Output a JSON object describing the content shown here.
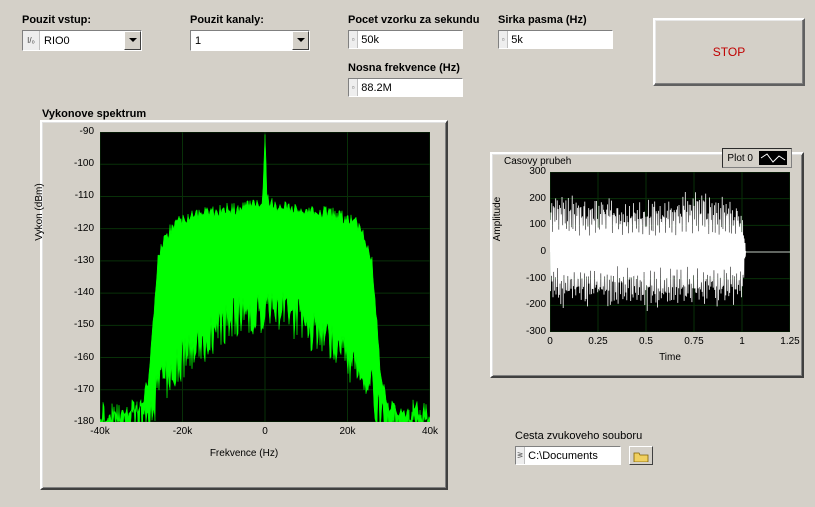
{
  "labels": {
    "input": "Pouzit vstup:",
    "channels": "Pouzit kanaly:",
    "samples": "Pocet vzorku za sekundu",
    "bandwidth": "Sirka pasma (Hz)",
    "carrier": "Nosna frekvence (Hz)",
    "stop": "STOP",
    "spectrum_title": "Vykonove spektrum",
    "spectrum_x": "Frekvence (Hz)",
    "spectrum_y": "Vykon (dBm)",
    "waveform_title": "Casovy prubeh",
    "waveform_x": "Time",
    "waveform_y": "Amplitude",
    "legend": "Plot 0",
    "filepath_label": "Cesta zvukoveho souboru"
  },
  "values": {
    "input": "RIO0",
    "channels": "1",
    "samples": "50k",
    "bandwidth": "5k",
    "carrier": "88.2M",
    "filepath": "C:\\Documents"
  },
  "chart_data": [
    {
      "type": "area",
      "title": "Vykonove spektrum",
      "xlabel": "Frekvence (Hz)",
      "ylabel": "Vykon (dBm)",
      "xlim": [
        -40000,
        40000
      ],
      "ylim": [
        -180,
        -90
      ],
      "xticks": [
        -40000,
        -20000,
        0,
        20000,
        40000
      ],
      "xticklabels": [
        "-40k",
        "-20k",
        "0",
        "20k",
        "40k"
      ],
      "yticks": [
        -180,
        -170,
        -160,
        -150,
        -140,
        -130,
        -120,
        -110,
        -100,
        -90
      ],
      "series": [
        {
          "name": "Vykon",
          "color": "#00ff00",
          "x": [
            -40000,
            -35000,
            -32000,
            -30000,
            -28000,
            -26000,
            -25000,
            -22000,
            -20000,
            -18000,
            -15000,
            -12000,
            -10000,
            -8000,
            -6000,
            -4000,
            -2000,
            -500,
            0,
            500,
            2000,
            4000,
            6000,
            8000,
            10000,
            12000,
            15000,
            18000,
            20000,
            22000,
            25000,
            26000,
            28000,
            30000,
            32000,
            35000,
            40000
          ],
          "y_top": [
            -180,
            -178,
            -176,
            -175,
            -165,
            -130,
            -125,
            -118,
            -117,
            -116,
            -115,
            -115,
            -114,
            -114,
            -114,
            -113,
            -113,
            -110,
            -92,
            -110,
            -113,
            -113,
            -114,
            -114,
            -114,
            -115,
            -115,
            -116,
            -117,
            -118,
            -125,
            -130,
            -165,
            -175,
            -176,
            -178,
            -180
          ],
          "y_bot": [
            -180,
            -180,
            -180,
            -180,
            -178,
            -170,
            -168,
            -164,
            -160,
            -158,
            -155,
            -152,
            -150,
            -148,
            -147,
            -146,
            -146,
            -146,
            -146,
            -146,
            -146,
            -146,
            -147,
            -148,
            -150,
            -152,
            -155,
            -158,
            -160,
            -164,
            -168,
            -170,
            -178,
            -180,
            -180,
            -180,
            -180
          ]
        }
      ]
    },
    {
      "type": "line",
      "title": "Casovy prubeh",
      "xlabel": "Time",
      "ylabel": "Amplitude",
      "xlim": [
        0,
        1.25
      ],
      "ylim": [
        -300,
        300
      ],
      "xticks": [
        0,
        0.25,
        0.5,
        0.75,
        1,
        1.25
      ],
      "yticks": [
        -300,
        -200,
        -100,
        0,
        100,
        200,
        300
      ],
      "grid": true,
      "series": [
        {
          "name": "Plot 0",
          "color": "#ffffff",
          "note": "dense audio waveform fills [0,1], amplitude envelope ~±200–250, silent after x≈1.02",
          "envelope_x": [
            0,
            0.05,
            0.1,
            0.2,
            0.3,
            0.4,
            0.5,
            0.6,
            0.7,
            0.8,
            0.9,
            1.0,
            1.02,
            1.25
          ],
          "envelope_top": [
            200,
            240,
            220,
            210,
            230,
            200,
            220,
            210,
            230,
            220,
            210,
            200,
            0,
            0
          ],
          "envelope_bot": [
            -200,
            -230,
            -220,
            -210,
            -220,
            -200,
            -230,
            -215,
            -225,
            -220,
            -210,
            -200,
            0,
            0
          ]
        }
      ]
    }
  ]
}
